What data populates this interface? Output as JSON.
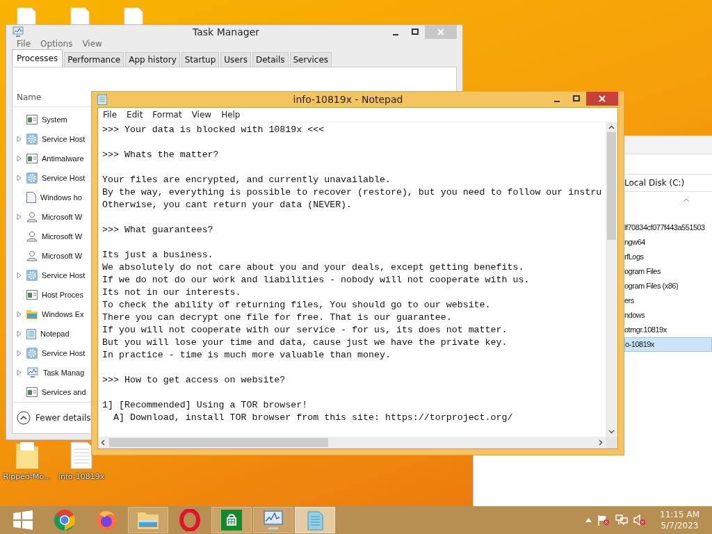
{
  "desktop": {
    "top_icons": [
      {
        "kind": "file"
      },
      {
        "kind": "file"
      },
      {
        "kind": "file"
      }
    ],
    "bottom_icons": [
      {
        "kind": "folder",
        "label": "Ripped-Mo..."
      },
      {
        "kind": "text",
        "label": "info-10819x"
      }
    ]
  },
  "task_manager": {
    "title": "Task Manager",
    "menu": [
      "File",
      "Options",
      "View"
    ],
    "tabs": [
      {
        "label": "Processes",
        "selected": true
      },
      {
        "label": "Performance",
        "selected": false
      },
      {
        "label": "App history",
        "selected": false
      },
      {
        "label": "Startup",
        "selected": false
      },
      {
        "label": "Users",
        "selected": false
      },
      {
        "label": "Details",
        "selected": false
      },
      {
        "label": "Services",
        "selected": false
      }
    ],
    "column": "Name",
    "processes": [
      {
        "name": "System",
        "kind": "window",
        "expandable": false
      },
      {
        "name": "Service Host",
        "kind": "gear",
        "expandable": true
      },
      {
        "name": "Antimalware",
        "kind": "window",
        "expandable": true
      },
      {
        "name": "Service Host",
        "kind": "gear",
        "expandable": true
      },
      {
        "name": "Windows ho",
        "kind": "page",
        "expandable": false
      },
      {
        "name": "Microsoft W",
        "kind": "user",
        "expandable": true
      },
      {
        "name": "Microsoft W",
        "kind": "user",
        "expandable": false
      },
      {
        "name": "Microsoft W",
        "kind": "user",
        "expandable": false
      },
      {
        "name": "Service Host",
        "kind": "gear",
        "expandable": true
      },
      {
        "name": "Host Proces",
        "kind": "window",
        "expandable": false
      },
      {
        "name": "Windows Ex",
        "kind": "folder",
        "expandable": true
      },
      {
        "name": "Notepad",
        "kind": "notepad",
        "expandable": true
      },
      {
        "name": "Service Host",
        "kind": "gear",
        "expandable": true
      },
      {
        "name": "Task Manag",
        "kind": "monitor",
        "expandable": true
      },
      {
        "name": "Services and",
        "kind": "window",
        "expandable": false
      }
    ],
    "footer": "Fewer details"
  },
  "explorer": {
    "address": "Local Disk (C:)",
    "items": [
      {
        "name": "lf70834cf077f443a551503",
        "selected": false
      },
      {
        "name": "ngw64",
        "selected": false
      },
      {
        "name": "rfLogs",
        "selected": false
      },
      {
        "name": "ogram Files",
        "selected": false
      },
      {
        "name": "ogram Files (x86)",
        "selected": false
      },
      {
        "name": "ers",
        "selected": false
      },
      {
        "name": "ndows",
        "selected": false
      },
      {
        "name": "otmgr.10819x",
        "selected": false
      },
      {
        "name": "o-10819x",
        "selected": true
      }
    ]
  },
  "notepad": {
    "title": "info-10819x - Notepad",
    "menu": [
      "File",
      "Edit",
      "Format",
      "View",
      "Help"
    ],
    "blocks": [
      [
        ">>> Your data is blocked with 10819x <<<"
      ],
      [
        ">>> Whats the matter?"
      ],
      [
        "Your files are encrypted, and currently unavailable.",
        "By the way, everything is possible to recover (restore), but you need to follow our instru",
        "Otherwise, you cant return your data (NEVER)."
      ],
      [
        ">>> What guarantees?"
      ],
      [
        "Its just a business.",
        "We absolutely do not care about you and your deals, except getting benefits.",
        "If we do not do our work and liabilities - nobody will not cooperate with us.",
        "Its not in our interests.",
        "To check the ability of returning files, You should go to our website.",
        "There you can decrypt one file for free. That is our guarantee.",
        "If you will not cooperate with our service - for us, its does not matter.",
        "But you will lose your time and data, cause just we have the private key.",
        "In practice - time is much more valuable than money."
      ],
      [
        ">>> How to get access on website?"
      ],
      [
        "1] [Recommended] Using a TOR browser!",
        "  A] Download, install TOR browser from this site: https://torproject.org/"
      ]
    ]
  },
  "taskbar": {
    "apps": [
      {
        "kind": "start",
        "running": false,
        "selected": false
      },
      {
        "kind": "chrome",
        "running": false,
        "selected": false
      },
      {
        "kind": "firefox",
        "running": false,
        "selected": false
      },
      {
        "kind": "explorer",
        "running": true,
        "selected": false
      },
      {
        "kind": "opera",
        "running": false,
        "selected": false
      },
      {
        "kind": "store",
        "running": true,
        "selected": false
      },
      {
        "kind": "taskmgr",
        "running": true,
        "selected": false
      },
      {
        "kind": "notepad",
        "running": true,
        "selected": true
      }
    ],
    "time": "11:15 AM",
    "date": "5/7/2023"
  }
}
